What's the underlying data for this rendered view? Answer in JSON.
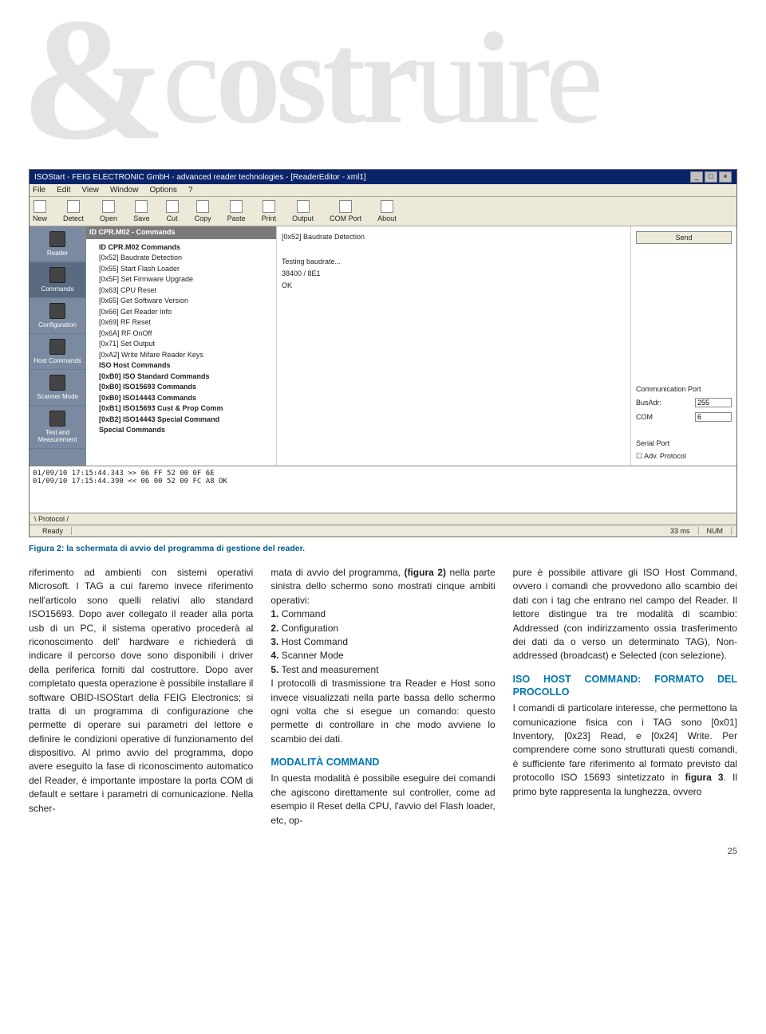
{
  "headline": {
    "amp": "&",
    "c1": "c",
    "os": "os",
    "tr": "tr",
    "u": "u",
    "i": "i",
    "re": "re"
  },
  "screenshot": {
    "title": "ISOStart - FEIG ELECTRONIC GmbH - advanced reader technologies - [ReaderEditor - xml1]",
    "menu": [
      "File",
      "Edit",
      "View",
      "Window",
      "Options",
      "?"
    ],
    "tools": [
      "New",
      "Detect",
      "Open",
      "Save",
      "Cut",
      "Copy",
      "Paste",
      "Print",
      "Output",
      "COM Port",
      "About"
    ],
    "sidebar": [
      "Reader",
      "Commands",
      "Configuration",
      "Host Commands",
      "Scanner Mode",
      "Test and Measurement"
    ],
    "tree_title": "ID CPR.M02 - Commands",
    "tree_root": "ID CPR.M02 Commands",
    "tree_items": [
      "[0x52] Baudrate Detection",
      "[0x55] Start Flash Loader",
      "[0x5F] Set Firmware Upgrade",
      "[0x63] CPU Reset",
      "[0x65] Get Software Version",
      "[0x66] Get Reader Info",
      "[0x69] RF Reset",
      "[0x6A] RF OnOff",
      "[0x71] Set Output",
      "[0xA2] Write Mifare Reader Keys"
    ],
    "tree_root2": "ISO Host Commands",
    "tree_items2": [
      "[0xB0] ISO Standard Commands",
      "[0xB0] ISO15693 Commands",
      "[0xB0] ISO14443 Commands",
      "[0xB1] ISO15693 Cust & Prop Comm",
      "[0xB2] ISO14443 Special Command",
      "Special Commands"
    ],
    "center": {
      "header": "[0x52] Baudrate Detection",
      "line1": "Testing baudrate...",
      "line2": "38400 / 8E1",
      "line3": "OK"
    },
    "right": {
      "send": "Send",
      "commport": "Communication Port",
      "busadr_label": "BusAdr:",
      "busadr": "255",
      "com_label": "COM",
      "com": "6",
      "serial": "Serial Port",
      "adv": "Adv. Protocol"
    },
    "log": {
      "l1": "01/09/10 17:15:44.343  >>  06 FF 52 00 0F 6E",
      "l2": "01/09/10 17:15:44.390  <<  06 00 52 00 FC A8    OK"
    },
    "logtab": "Protocol",
    "status": {
      "ready": "Ready",
      "ms": "33 ms",
      "num": "NUM"
    }
  },
  "caption": "Figura 2: la schermata di avvio del programma di gestione del reader.",
  "col1": {
    "p": "riferimento ad ambienti con sistemi operativi Microsoft. I TAG a cui faremo invece riferimento nell'articolo sono quelli relativi allo standard ISO15693. Dopo aver collegato il reader alla porta usb di un PC, il sistema operativo procederà al riconoscimento dell' hardware e richiederà di indicare il percorso dove sono disponibili i driver della periferica forniti dal costruttore. Dopo aver completato questa operazione è possibile installare il software OBID-ISOStart della FEIG Electronics; si tratta di un programma di configurazione che permette di operare sui parametri del lettore e definire le condizioni operative di funzionamento del dispositivo. Al primo avvio del programma, dopo avere eseguito la fase di riconoscimento automatico del Reader, è importante impostare la porta COM di default e settare i parametri di comunicazione. Nella scher-"
  },
  "col2": {
    "p1a": "mata di avvio del programma, ",
    "p1b": "(figura 2)",
    "p1c": " nella parte sinistra dello schermo sono mostrati cinque ambiti operativi:",
    "list": [
      "Command",
      "Configuration",
      "Host Command",
      "Scanner Mode",
      "Test and measurement"
    ],
    "p2": "I protocolli di trasmissione tra Reader e Host sono invece visualizzati nella parte bassa dello schermo ogni volta che si esegue un comando: questo permette di controllare in che modo avviene lo scambio dei dati.",
    "h": "MODALITÀ COMMAND",
    "p3": "In questa modalità è possibile eseguire dei comandi che agiscono direttamente sul controller, come ad esempio il Reset della CPU, l'avvio del Flash loader, etc, op-"
  },
  "col3": {
    "p1": "pure è possibile attivare gli ISO Host Command, ovvero i comandi che provvedono allo scambio dei dati con i tag che entrano nel campo del Reader. Il lettore distingue tra tre modalità di scambio: Addressed (con indirizzamento ossia trasferimento dei dati da o verso un determinato TAG), Non-addressed (broadcast) e Selected (con selezione).",
    "h": "ISO HOST COMMAND: FORMATO DEL PROCOLLO",
    "p2a": "I comandi di particolare interesse, che permettono la comunicazione fisica con i TAG sono [0x01] Inventory, [0x23] Read, e [0x24] Write. Per comprendere come sono strutturati questi comandi, è sufficiente fare riferimento al formato previsto dal protocollo ISO 15693 sintetizzato in ",
    "p2b": "figura 3",
    "p2c": ". Il primo byte rappresenta la lunghezza, ovvero"
  },
  "pagenum": "25"
}
